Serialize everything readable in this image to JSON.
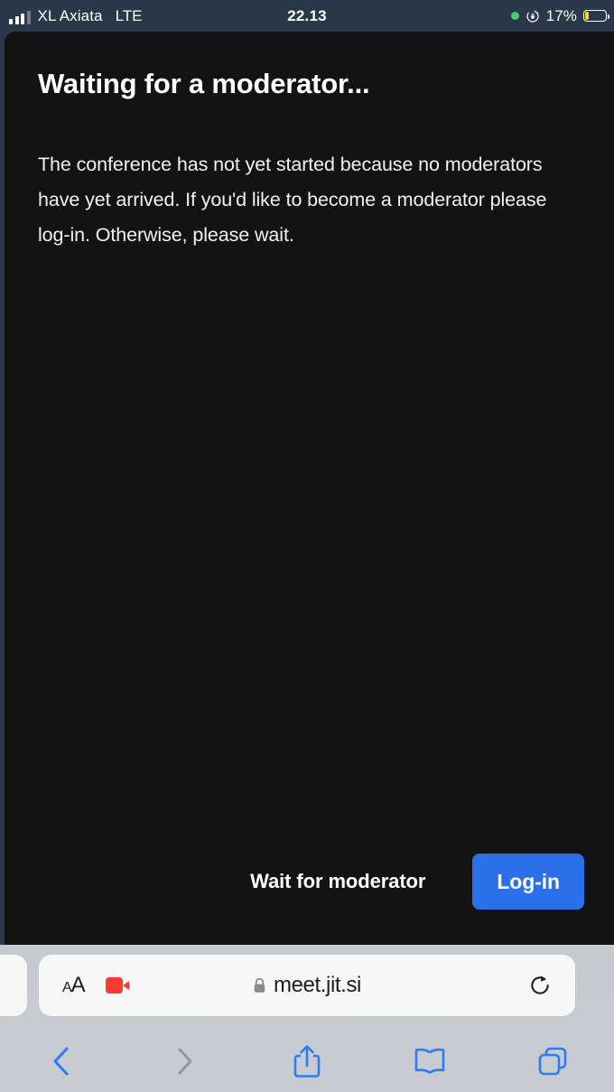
{
  "status_bar": {
    "carrier": "XL Axiata",
    "network": "LTE",
    "time": "22.13",
    "battery_percent": "17%",
    "signal_bars_filled": 3,
    "signal_bars_total": 4,
    "icons": {
      "green_dot": "recording-indicator",
      "rotation_lock": "rotation-lock-icon",
      "battery": "battery-icon"
    },
    "colors": {
      "background": "#2b3849",
      "text": "#ffffff",
      "green_dot": "#3ed36a",
      "battery_fill": "#ffd60a"
    }
  },
  "page": {
    "title": "Waiting for a moderator...",
    "body": "The conference has not yet started because no moderators have yet arrived. If you'd like to become a moderator please log-in. Otherwise, please wait.",
    "wait_button": "Wait for moderator",
    "login_button": "Log-in",
    "colors": {
      "background": "#131313",
      "text": "#ffffff",
      "accent": "#2b70e8"
    }
  },
  "browser": {
    "text_size_small": "A",
    "text_size_big": "A",
    "url": "meet.jit.si",
    "lock": "secure-lock-icon",
    "camera_indicator": "camera-active-icon",
    "reload": "reload-icon",
    "toolbar": [
      {
        "name": "back",
        "icon": "chevron-left-icon",
        "enabled": true
      },
      {
        "name": "forward",
        "icon": "chevron-right-icon",
        "enabled": false
      },
      {
        "name": "share",
        "icon": "share-icon",
        "enabled": true
      },
      {
        "name": "bookmarks",
        "icon": "book-icon",
        "enabled": true
      },
      {
        "name": "tabs",
        "icon": "tabs-icon",
        "enabled": true
      }
    ],
    "colors": {
      "chrome": "#c7ccd2",
      "tab": "#f7f7f8",
      "tint": "#2b7cf6",
      "disabled": "#8e959d"
    }
  }
}
